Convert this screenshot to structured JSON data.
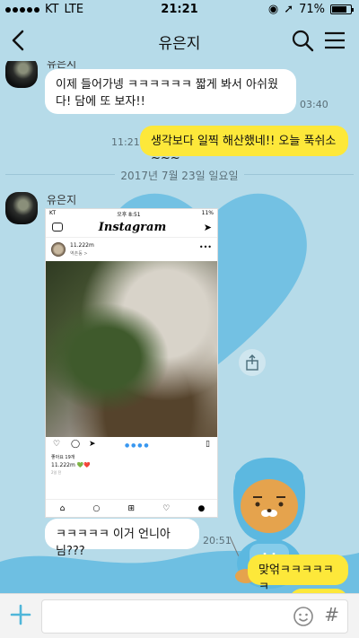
{
  "status_bar": {
    "carrier": "KT",
    "network": "LTE",
    "time": "21:21",
    "battery": "71%"
  },
  "header": {
    "title": "유은지"
  },
  "messages": {
    "m1": {
      "sender": "유은지",
      "text": "이제 들어가넹 ㅋㅋㅋㅋㅋㅋ 짧게 봐서 아쉬웠다! 담에 또 보자!!",
      "time": "03:40"
    },
    "m2": {
      "text": "생각보다 일찍 해산했네!! 오늘 푹쉬소~~~",
      "time": "11:21"
    },
    "date": "2017년 7월 23일 일요일",
    "m3": {
      "sender": "유은지",
      "time": "20:51"
    },
    "m4": {
      "text": "ㅋㅋㅋㅋㅋ 이거 언니아님???"
    },
    "m5": {
      "text": "맞얶ㅋㅋㅋㅋㅋㅋ"
    }
  },
  "instagram_shot": {
    "status_carrier": "KT",
    "status_time": "오후 8:51",
    "status_battery": "11%",
    "logo": "Instagram",
    "username": "11.222m",
    "location": "역촌동 >",
    "likes": "좋아요 19개",
    "caption_user": "11.222m 💚❤️",
    "posted": "2일 전"
  },
  "colors": {
    "background": "#b6dbe9",
    "my_bubble": "#fde83a",
    "heart": "#5cb8e0"
  }
}
